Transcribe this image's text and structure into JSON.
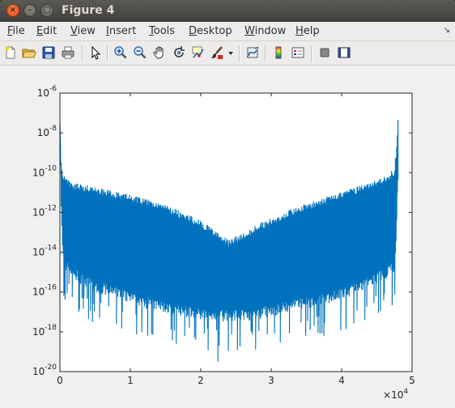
{
  "window": {
    "title": "Figure 4"
  },
  "menubar": {
    "items": [
      {
        "label": "File",
        "accel": "F",
        "rest": "ile"
      },
      {
        "label": "Edit",
        "accel": "E",
        "rest": "dit"
      },
      {
        "label": "View",
        "accel": "V",
        "rest": "iew"
      },
      {
        "label": "Insert",
        "accel": "I",
        "rest": "nsert"
      },
      {
        "label": "Tools",
        "accel": "T",
        "rest": "ools"
      },
      {
        "label": "Desktop",
        "accel": "D",
        "rest": "esktop"
      },
      {
        "label": "Window",
        "accel": "W",
        "rest": "indow"
      },
      {
        "label": "Help",
        "accel": "H",
        "rest": "elp"
      }
    ]
  },
  "toolbar": {
    "icons": [
      "new-figure-icon",
      "open-file-icon",
      "save-icon",
      "print-icon",
      "edit-plot-arrow-icon",
      "zoom-in-icon",
      "zoom-out-icon",
      "pan-hand-icon",
      "rotate-3d-icon",
      "data-cursor-icon",
      "brush-icon",
      "brush-dropdown-icon",
      "link-plot-icon",
      "colorbar-icon",
      "legend-icon",
      "hide-plot-tools-icon",
      "show-plot-tools-icon"
    ]
  },
  "chart_data": {
    "type": "line",
    "title": "",
    "xlabel": "",
    "ylabel": "",
    "x_exponent_label": "10",
    "x_exponent": "4",
    "xlim": [
      0,
      5
    ],
    "ylim": [
      1e-20,
      1e-06
    ],
    "yscale": "log",
    "grid": false,
    "x_ticks": [
      "0",
      "1",
      "2",
      "3",
      "4",
      "5"
    ],
    "y_ticks": [
      {
        "base": "10",
        "exp": "-20"
      },
      {
        "base": "10",
        "exp": "-18"
      },
      {
        "base": "10",
        "exp": "-16"
      },
      {
        "base": "10",
        "exp": "-14"
      },
      {
        "base": "10",
        "exp": "-12"
      },
      {
        "base": "10",
        "exp": "-10"
      },
      {
        "base": "10",
        "exp": "-8"
      },
      {
        "base": "10",
        "exp": "-6"
      }
    ],
    "line_color": "#0072bd",
    "series": [
      {
        "x": [
          0,
          0.02,
          0.05,
          0.2,
          0.5,
          1.0,
          1.5,
          2.0,
          2.4,
          2.8,
          3.3,
          3.8,
          4.3,
          4.6,
          4.75,
          4.78,
          4.8
        ],
        "upper_exp": [
          -7.8,
          -9.5,
          -10.1,
          -10.5,
          -10.7,
          -11.1,
          -11.6,
          -12.4,
          -13.4,
          -12.6,
          -11.8,
          -11.2,
          -10.6,
          -10.2,
          -9.8,
          -8.6,
          -7.2
        ],
        "lower_exp": [
          -8.0,
          -12.5,
          -14.8,
          -15.4,
          -16.0,
          -16.6,
          -17.1,
          -17.4,
          -17.5,
          -17.4,
          -17.0,
          -16.6,
          -16.0,
          -15.4,
          -15.0,
          -13.0,
          -9.5
        ],
        "deep_spike_exp": -19.6
      }
    ]
  }
}
